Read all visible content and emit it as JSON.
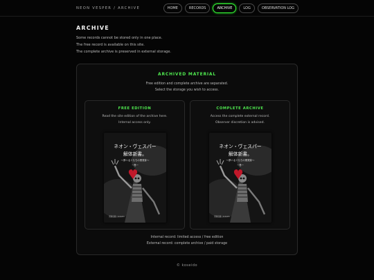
{
  "header": {
    "brand": "NEON VESPER / ARCHIVE",
    "nav": [
      {
        "label": "HOME",
        "active": false
      },
      {
        "label": "RECORDS",
        "active": false
      },
      {
        "label": "ARCHIVE",
        "active": true
      },
      {
        "label": "LOG",
        "active": false
      },
      {
        "label": "OBSERVATION LOG",
        "active": false
      }
    ]
  },
  "page": {
    "title": "ARCHIVE",
    "intro": [
      "Some records cannot be stored only in one place.",
      "The free record is available on this site.",
      "The complete archive is preserved in external storage."
    ]
  },
  "panel": {
    "title": "ARCHIVED MATERIAL",
    "desc": [
      "Free edition and complete archive are separated.",
      "Select the storage you wish to access."
    ],
    "cards": [
      {
        "title": "FREE EDITION",
        "desc": [
          "Read the site edition of the archive here.",
          "Internal access only."
        ],
        "cover": {
          "title_lines": [
            "ネオン・ヴェスパー",
            "解体新書。"
          ],
          "subtitle": "～夢ハるミたちの黒発芽～",
          "volume": "一巻一",
          "publisher": "黒骸出版 / kokaido"
        }
      },
      {
        "title": "COMPLETE ARCHIVE",
        "desc": [
          "Access the complete external record.",
          "Observer discretion is advised."
        ],
        "cover": {
          "title_lines": [
            "ネオン・ヴェスパー",
            "解体新書。"
          ],
          "subtitle": "～夢ハるミたちの黒発芽～",
          "volume": "一巻一",
          "publisher": "黒骸出版 / kokaido"
        }
      }
    ],
    "footer": [
      "Internal record: limited access / free edition",
      "External record: complete archive / paid storage"
    ]
  },
  "footer": {
    "text": "© koseido"
  },
  "colors": {
    "accent": "#4fe84f",
    "background": "#050505",
    "panel": "#0b0b0b"
  }
}
